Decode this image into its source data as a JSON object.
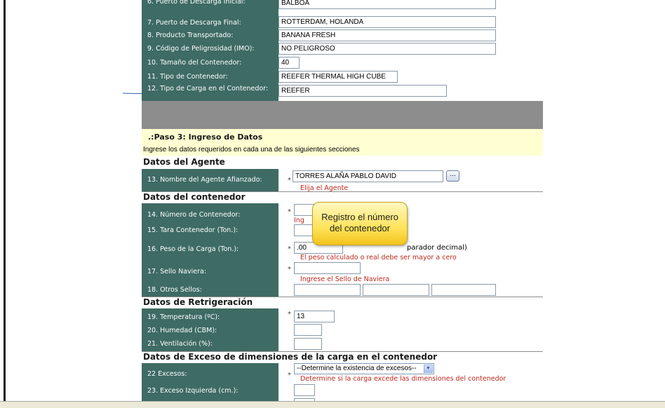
{
  "top_fields": [
    {
      "label": "6. Puerto de Descarga Inicial:",
      "value": "BALBOA"
    },
    {
      "label": "7. Puerto de Descarga Final:",
      "value": "ROTTERDAM, HOLANDA"
    },
    {
      "label": "8. Producto Transportado:",
      "value": "BANANA FRESH"
    },
    {
      "label": "9. Código de Peligrosidad (IMO):",
      "value": "NO PELIGROSO"
    },
    {
      "label": "10. Tamaño del Contenedor:",
      "value": "40"
    },
    {
      "label": "11. Tipo de Contenedor:",
      "value": "REEFER THERMAL HIGH CUBE"
    },
    {
      "label": "12. Tipo de Carga en el Contenedor:",
      "value": "REEFER"
    }
  ],
  "paso": {
    "title": ".:Paso 3: Ingreso de Datos",
    "subtitle": "Ingrese los datos requeridos en cada una de las siguientes secciones"
  },
  "agente": {
    "section": "Datos del Agente",
    "label": "13. Nombre del Agente Afianzado:",
    "value": "TORRES ALAÑA PABLO DAVID",
    "button": "...",
    "hint": "Elija el Agente"
  },
  "contenedor": {
    "section": "Datos del contenedor",
    "numero_label": "14. Número de Contenedor:",
    "numero_hint_visible": "Ing",
    "tara_label": "15. Tara Contenedor (Ton.):",
    "peso_label": "16. Peso de la Carga (Ton.):",
    "peso_value": ".00",
    "peso_note_visible": "parador decimal)",
    "peso_hint": "El peso calculado o real debe ser mayor a cero",
    "sello_label": "17. Sello Naviera:",
    "sello_hint": "Ingrese el Sello de Naviera",
    "otros_label": "18. Otros Sellos:"
  },
  "refrigeracion": {
    "section": "Datos de Retrigeración",
    "temp_label": "19. Temperatura (ºC):",
    "temp_value": "13",
    "humedad_label": "20. Humedad (CBM):",
    "ventilacion_label": "21. Ventilación (%):"
  },
  "exceso": {
    "section": "Datos de Exceso de dimensiones de la carga en el contenedor",
    "excesos_label": "22 Excesos:",
    "excesos_selected": "--Determine la existencia de excesos--",
    "excesos_hint": "Determine si la carga excede las dimensiones del contenedor",
    "izquierda_label": "23. Exceso Izquierda (cm.):"
  },
  "required_mark": "*",
  "callout": {
    "line1": "Registro el número",
    "line2": "del contenedor"
  },
  "colors": {
    "label_bg": "#3e6b64",
    "error": "#c0281e",
    "banner": "#ffffd2",
    "gray_band": "#8d8d8d",
    "callout": "#ffe35a"
  }
}
